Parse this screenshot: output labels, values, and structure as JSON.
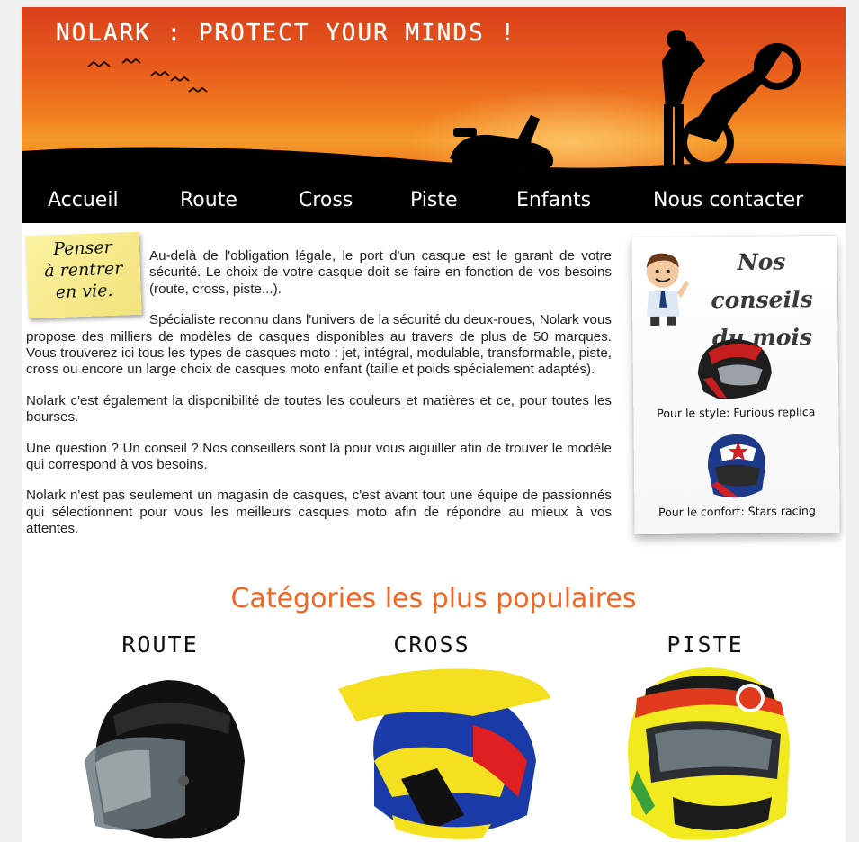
{
  "header": {
    "site_title": "NOLARK : PROTECT YOUR MINDS !"
  },
  "nav": {
    "items": [
      {
        "label": "Accueil"
      },
      {
        "label": "Route"
      },
      {
        "label": "Cross"
      },
      {
        "label": "Piste"
      },
      {
        "label": "Enfants"
      },
      {
        "label": "Nous contacter"
      }
    ]
  },
  "note": {
    "text_lines": [
      "Penser",
      "à rentrer",
      "en vie."
    ]
  },
  "intro": {
    "paragraphs": [
      "Au-delà de l'obligation légale, le port d'un casque est le garant de votre sécurité. Le choix de votre casque doit se faire en fonction de vos besoins (route, cross, piste...).",
      "Spécialiste reconnu dans l'univers de la sécurité du deux-roues, Nolark vous propose des milliers de modèles de casques disponibles au travers de plus de 50 marques. Vous trouverez ici tous les types de casques moto : jet, intégral, modulable, transformable, piste, cross ou encore un large choix de casques moto enfant (taille et poids spécialement adaptés).",
      "Nolark c'est également la disponibilité de toutes les couleurs et matières et ce, pour toutes les bourses.",
      "Une question ? Un conseil ? Nos conseillers sont là pour vous aiguiller afin de trouver le modèle qui correspond à vos besoins.",
      "Nolark n'est pas seulement un magasin de casques, c'est avant tout une équipe de passionnés qui sélectionnent pour vous les meilleurs casques moto afin de répondre au mieux à vos attentes."
    ]
  },
  "advice": {
    "title_line1": "Nos conseils",
    "title_line2": "du mois",
    "items": [
      {
        "caption": "Pour le style: Furious replica"
      },
      {
        "caption": "Pour le confort: Stars racing"
      }
    ]
  },
  "popular": {
    "title": "Catégories les plus populaires",
    "categories": [
      {
        "label": "ROUTE"
      },
      {
        "label": "CROSS"
      },
      {
        "label": "PISTE"
      }
    ]
  },
  "colors": {
    "accent": "#f26522",
    "nav_bg": "#000000",
    "banner_orange": "#f07a1e"
  }
}
